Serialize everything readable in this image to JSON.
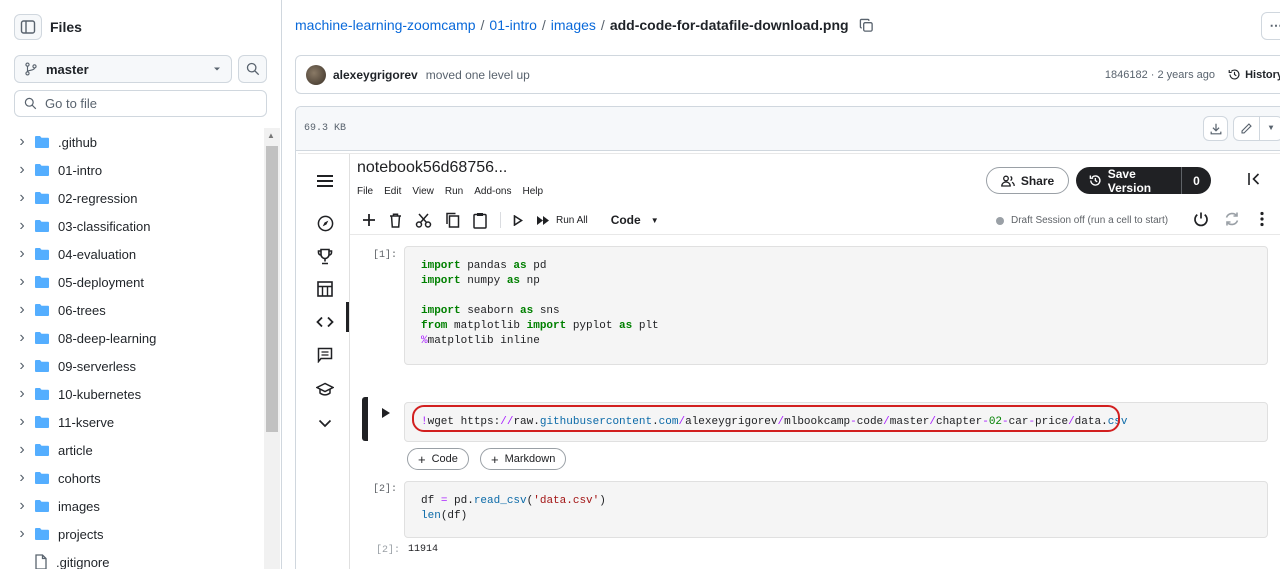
{
  "sidebar": {
    "title": "Files",
    "branch": "master",
    "goto_placeholder": "Go to file",
    "items": [
      {
        "label": ".github",
        "type": "folder"
      },
      {
        "label": "01-intro",
        "type": "folder"
      },
      {
        "label": "02-regression",
        "type": "folder"
      },
      {
        "label": "03-classification",
        "type": "folder"
      },
      {
        "label": "04-evaluation",
        "type": "folder"
      },
      {
        "label": "05-deployment",
        "type": "folder"
      },
      {
        "label": "06-trees",
        "type": "folder"
      },
      {
        "label": "08-deep-learning",
        "type": "folder"
      },
      {
        "label": "09-serverless",
        "type": "folder"
      },
      {
        "label": "10-kubernetes",
        "type": "folder"
      },
      {
        "label": "11-kserve",
        "type": "folder"
      },
      {
        "label": "article",
        "type": "folder"
      },
      {
        "label": "cohorts",
        "type": "folder"
      },
      {
        "label": "images",
        "type": "folder"
      },
      {
        "label": "projects",
        "type": "folder"
      },
      {
        "label": ".gitignore",
        "type": "file"
      }
    ]
  },
  "breadcrumb": {
    "repo": "machine-learning-zoomcamp",
    "dir1": "01-intro",
    "dir2": "images",
    "sep": "/",
    "file": "add-code-for-datafile-download.png"
  },
  "commit": {
    "author": "alexeygrigorev",
    "message": "moved one level up",
    "meta": "1846182 · 2 years ago",
    "history": "History"
  },
  "file": {
    "size": "69.3 KB"
  },
  "notebook": {
    "title": "notebook56d68756...",
    "menu": [
      "File",
      "Edit",
      "View",
      "Run",
      "Add-ons",
      "Help"
    ],
    "share": "Share",
    "save_version": "Save Version",
    "save_count": "0",
    "run_all": "Run All",
    "cell_type": "Code",
    "session": "Draft Session off (run a cell to start)",
    "cells": {
      "c1_label": "[1]:",
      "c2_label": "[2]:",
      "out_label": "[2]:",
      "output": "11914"
    },
    "add_code": "Code",
    "add_markdown": "Markdown"
  },
  "colors": {
    "link": "#0969da",
    "highlight": "#d21f1f",
    "folder": "#54aeff"
  }
}
